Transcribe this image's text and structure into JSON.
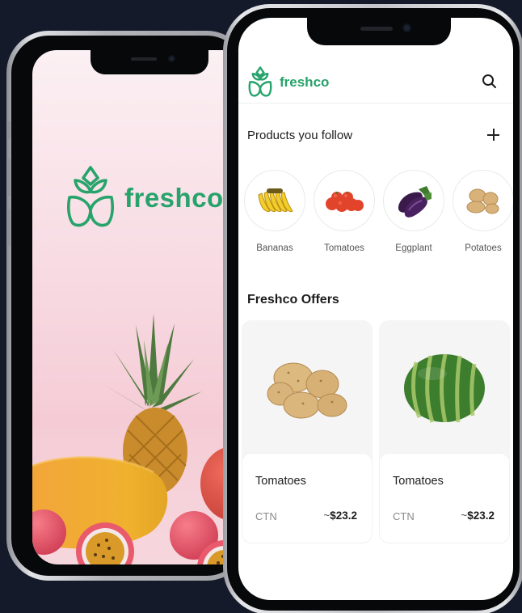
{
  "splash": {
    "brand": "freshco",
    "brand_color": "#27a36b"
  },
  "app": {
    "brand": "freshco",
    "search_icon": "search-icon",
    "follow": {
      "title": "Products you follow",
      "add_icon": "plus-icon",
      "items": [
        {
          "label": "Bananas"
        },
        {
          "label": "Tomatoes"
        },
        {
          "label": "Eggplant"
        },
        {
          "label": "Potatoes"
        }
      ]
    },
    "offers": {
      "title": "Freshco Offers",
      "cards": [
        {
          "name": "Tomatoes",
          "unit": "CTN",
          "price_prefix": "~",
          "price": "$23.2",
          "image": "potatoes"
        },
        {
          "name": "Tomatoes",
          "unit": "CTN",
          "price_prefix": "~",
          "price": "$23.2",
          "image": "watermelon"
        }
      ]
    }
  }
}
